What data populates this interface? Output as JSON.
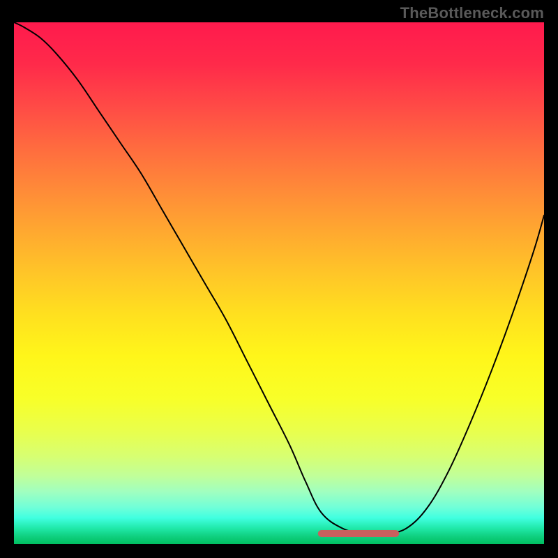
{
  "watermark": "TheBottleneck.com",
  "colors": {
    "background": "#000000",
    "curve": "#000000",
    "flat_segment": "#c9605e"
  },
  "chart_data": {
    "type": "line",
    "title": "",
    "xlabel": "",
    "ylabel": "",
    "xlim": [
      0,
      100
    ],
    "ylim": [
      0,
      100
    ],
    "series": [
      {
        "name": "bottleneck-curve",
        "x": [
          0,
          2,
          5,
          8,
          12,
          16,
          20,
          24,
          28,
          32,
          36,
          40,
          44,
          48,
          52,
          55,
          58,
          62,
          66,
          70,
          74,
          78,
          82,
          86,
          90,
          94,
          98,
          100
        ],
        "y": [
          100,
          99,
          97,
          94,
          89,
          83,
          77,
          71,
          64,
          57,
          50,
          43,
          35,
          27,
          19,
          12,
          6,
          3,
          2,
          2,
          3,
          7,
          14,
          23,
          33,
          44,
          56,
          63
        ]
      },
      {
        "name": "optimal-flat-segment",
        "x": [
          58,
          72
        ],
        "y": [
          2,
          2
        ]
      }
    ],
    "annotations": []
  }
}
